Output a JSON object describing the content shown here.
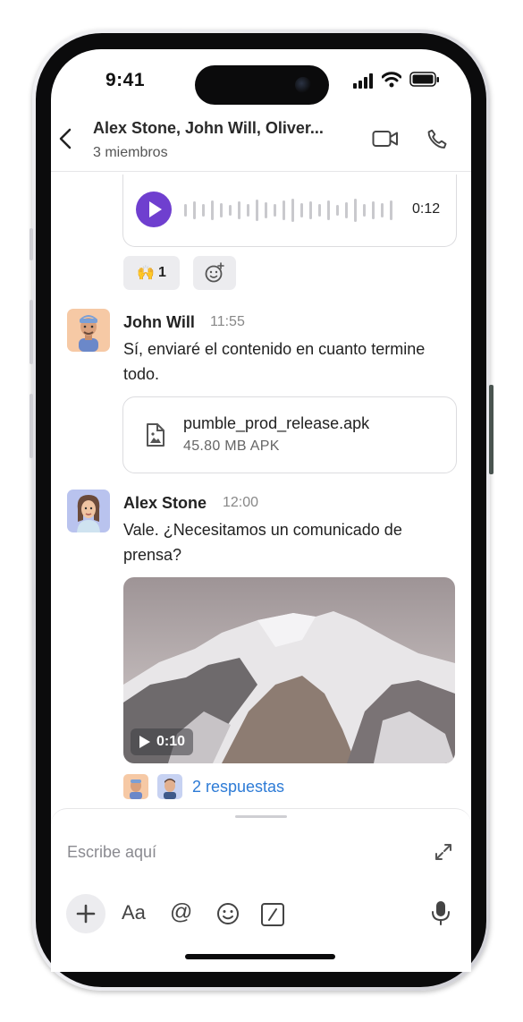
{
  "status_bar": {
    "time": "9:41"
  },
  "header": {
    "title": "Alex Stone, John Will, Oliver...",
    "subtitle": "3 miembros",
    "icons": [
      "back-icon",
      "video-call-icon",
      "phone-call-icon"
    ]
  },
  "voice_message": {
    "duration": "0:12",
    "reaction_emoji": "🙌",
    "reaction_count": "1"
  },
  "messages": [
    {
      "author": "John Will",
      "time": "11:55",
      "text": "Sí, enviaré el contenido en cuanto termine todo.",
      "attachment": {
        "file_name": "pumble_prod_release.apk",
        "file_meta": "45.80 MB APK"
      }
    },
    {
      "author": "Alex Stone",
      "time": "12:00",
      "text": "Vale. ¿Necesitamos un comunicado de prensa?",
      "video": {
        "duration": "0:10"
      },
      "replies_label": "2 respuestas"
    }
  ],
  "composer": {
    "placeholder": "Escribe aquí",
    "format_label": "Aa",
    "mention_label": "@"
  },
  "colors": {
    "accent": "#6f3fcf",
    "link": "#2d7bd6"
  }
}
